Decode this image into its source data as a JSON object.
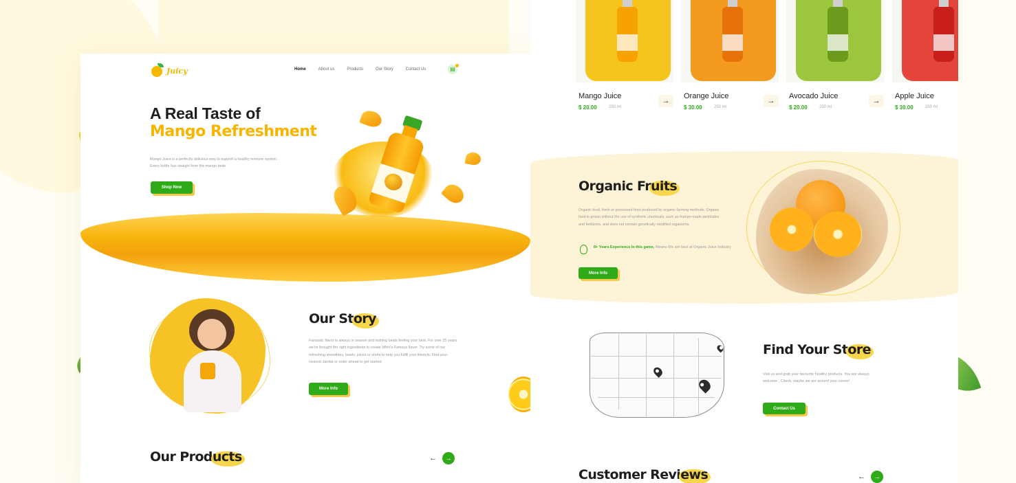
{
  "left_page": {
    "brand": {
      "name": "Juicy"
    },
    "nav": {
      "items": [
        {
          "label": "Home",
          "active": true
        },
        {
          "label": "About us",
          "active": false
        },
        {
          "label": "Products",
          "active": false
        },
        {
          "label": "Our Story",
          "active": false
        },
        {
          "label": "Contact Us",
          "active": false
        }
      ],
      "cart_icon": "basket-icon"
    },
    "hero": {
      "title": "A Real Taste of",
      "subtitle": "Mango Refreshment",
      "description": "Mango Juice is a perfectly delicious way to support a healthy immune system. Every bottle has straight from the mango taste",
      "button": "Shop Now"
    },
    "story": {
      "title_plain": "Our St",
      "title_highlight": "ory",
      "description": "Fantastic flavor is always in season and nothing beats feeling your best. For over 25 years we've brought the right ingredients to create Whirl's Famous flavor. Try some of our refreshing smoothies, bowls, juices or shots to help you fulfill your lifestyle. Find your nearest Jamba or order ahead to get started",
      "button": "More Info"
    },
    "products_section": {
      "title_plain": "Our Prod",
      "title_highlight": "ucts",
      "prev_icon": "arrow-left-icon",
      "next_icon": "arrow-right-icon"
    }
  },
  "right_page": {
    "products": [
      {
        "name": "Mango Juice",
        "price": "$ 20.00",
        "qty": "250 ml",
        "color": "#f6c51d",
        "bottle": "#f7a200"
      },
      {
        "name": "Orange Juice",
        "price": "$ 30.00",
        "qty": "250 ml",
        "color": "#f39a1f",
        "bottle": "#e7720a"
      },
      {
        "name": "Avocado Juice",
        "price": "$ 20.00",
        "qty": "250 ml",
        "color": "#9cc63e",
        "bottle": "#6c9a1c"
      },
      {
        "name": "Apple Juice",
        "price": "$ 30.00",
        "qty": "250 ml",
        "color": "#e5443b",
        "bottle": "#c81f1a"
      }
    ],
    "organic": {
      "title_plain": "Organic Fr",
      "title_highlight": "uits",
      "description": "Organic food, fresh or processed food produced by organic farming methods. Organic food is grown without the use of synthetic chemicals, such as human-made pesticides and fertilizers, and does not contain genetically modified organisms.",
      "experience_bold": "8+ Years Experience In this game,",
      "experience_rest": "Means We are best at Organic Juice Industry",
      "button": "More Info"
    },
    "store": {
      "title_plain": "Find Your St",
      "title_highlight": "ore",
      "description": "Visit us and grab your favourite healthy products. You are always welcome , Check, maybe we are around your corner!",
      "button": "Contact Us"
    },
    "reviews": {
      "title_plain": "Customer Revi",
      "title_highlight": "ews"
    }
  },
  "colors": {
    "accent_green": "#2fab1a",
    "accent_yellow": "#f7b500",
    "highlight": "#f8d64b"
  }
}
